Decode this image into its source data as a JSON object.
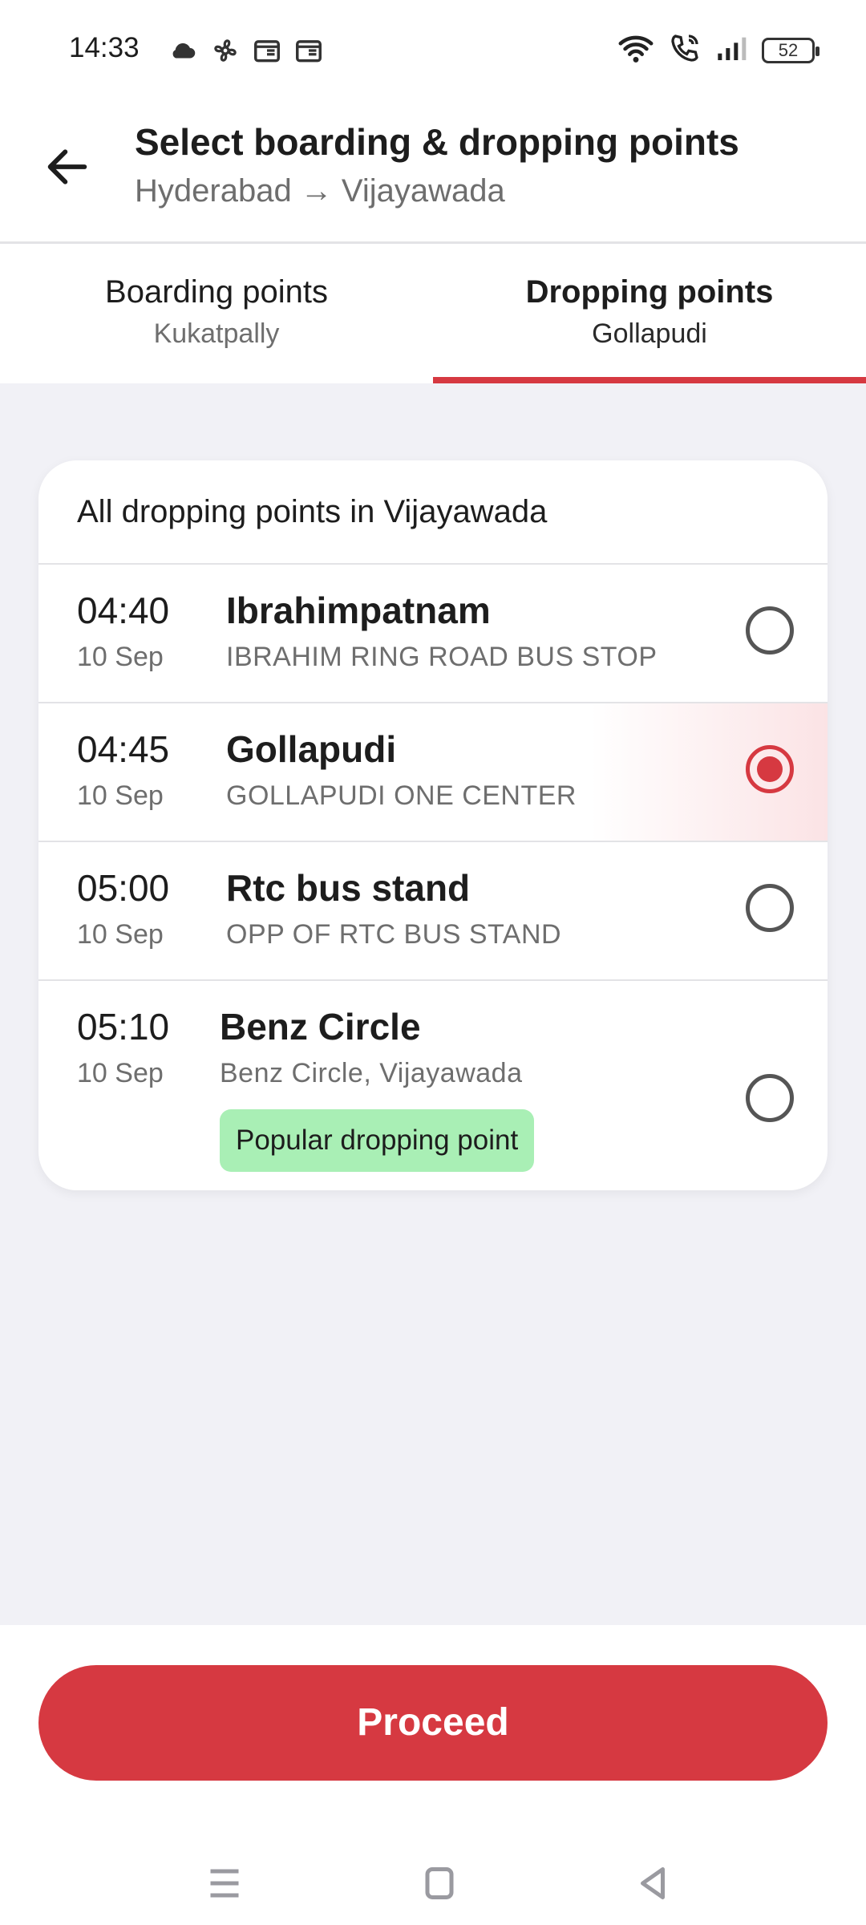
{
  "status_bar": {
    "time": "14:33",
    "battery": "52"
  },
  "header": {
    "title": "Select boarding & dropping points",
    "subtitle": "Hyderabad → Vijayawada"
  },
  "tabs": [
    {
      "label": "Boarding points",
      "sub": "Kukatpally",
      "active": false
    },
    {
      "label": "Dropping points",
      "sub": "Gollapudi",
      "active": true
    }
  ],
  "card": {
    "header": "All dropping points in Vijayawada",
    "points": [
      {
        "time": "04:40",
        "date": "10 Sep",
        "name": "Ibrahimpatnam",
        "address": "IBRAHIM RING ROAD BUS STOP",
        "selected": false
      },
      {
        "time": "04:45",
        "date": "10 Sep",
        "name": "Gollapudi",
        "address": "GOLLAPUDI ONE CENTER",
        "selected": true
      },
      {
        "time": "05:00",
        "date": "10 Sep",
        "name": "Rtc bus stand",
        "address": "OPP OF RTC BUS STAND",
        "selected": false
      },
      {
        "time": "05:10",
        "date": "10 Sep",
        "name": "Benz Circle",
        "address": "Benz Circle, Vijayawada",
        "selected": false,
        "badge": "Popular dropping point"
      }
    ]
  },
  "footer": {
    "proceed_label": "Proceed"
  },
  "colors": {
    "accent": "#d63941",
    "badge_bg": "#a9efb5",
    "background": "#f1f1f6"
  }
}
